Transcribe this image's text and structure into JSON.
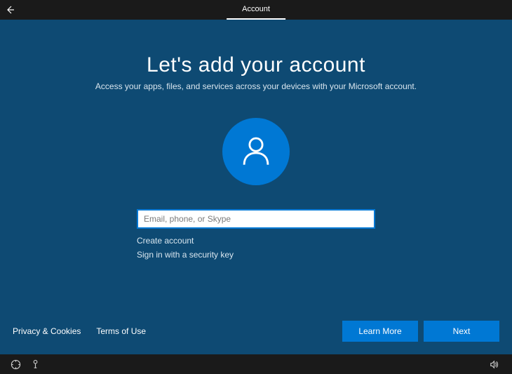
{
  "header": {
    "tab_label": "Account"
  },
  "main": {
    "title": "Let's add your account",
    "subtitle": "Access your apps, files, and services across your devices with your Microsoft account.",
    "input_placeholder": "Email, phone, or Skype",
    "create_account_label": "Create account",
    "security_key_label": "Sign in with a security key"
  },
  "footer": {
    "privacy_label": "Privacy & Cookies",
    "terms_label": "Terms of Use",
    "learn_more_label": "Learn More",
    "next_label": "Next"
  }
}
